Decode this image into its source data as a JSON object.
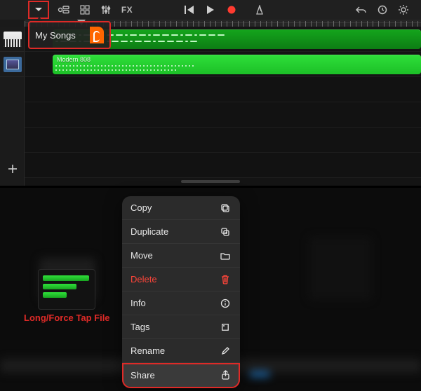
{
  "toolbar": {
    "fx_label": "FX"
  },
  "popover": {
    "title": "My Songs"
  },
  "tracks": [
    {
      "id": "track-piano",
      "region_label": ""
    },
    {
      "id": "track-beat",
      "region_label": "Modern 808"
    }
  ],
  "annotation": {
    "longtap": "Long/Force Tap File"
  },
  "context_menu": {
    "items": [
      {
        "key": "copy",
        "label": "Copy",
        "danger": false
      },
      {
        "key": "duplicate",
        "label": "Duplicate",
        "danger": false
      },
      {
        "key": "move",
        "label": "Move",
        "danger": false
      },
      {
        "key": "delete",
        "label": "Delete",
        "danger": true
      },
      {
        "key": "info",
        "label": "Info",
        "danger": false
      },
      {
        "key": "tags",
        "label": "Tags",
        "danger": false
      },
      {
        "key": "rename",
        "label": "Rename",
        "danger": false
      },
      {
        "key": "share",
        "label": "Share",
        "danger": false
      }
    ]
  }
}
